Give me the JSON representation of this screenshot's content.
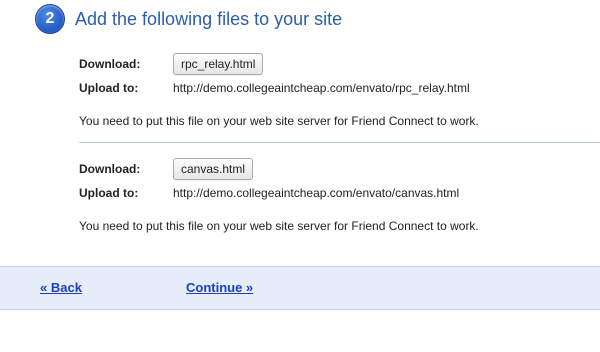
{
  "step": {
    "number": "2",
    "title": "Add the following files to your site"
  },
  "files": [
    {
      "download_label": "Download:",
      "button_label": "rpc_relay.html",
      "upload_label": "Upload to:",
      "upload_url": "http://demo.collegeaintcheap.com/envato/rpc_relay.html",
      "note": "You need to put this file on your web site server for Friend Connect to work."
    },
    {
      "download_label": "Download:",
      "button_label": "canvas.html",
      "upload_label": "Upload to:",
      "upload_url": "http://demo.collegeaintcheap.com/envato/canvas.html",
      "note": "You need to put this file on your web site server for Friend Connect to work."
    }
  ],
  "footer": {
    "back_label": "« Back",
    "continue_label": "Continue »"
  },
  "colors": {
    "accent": "#2a5db0",
    "link": "#1a3fc0",
    "footer_background": "#e6ecf8"
  }
}
